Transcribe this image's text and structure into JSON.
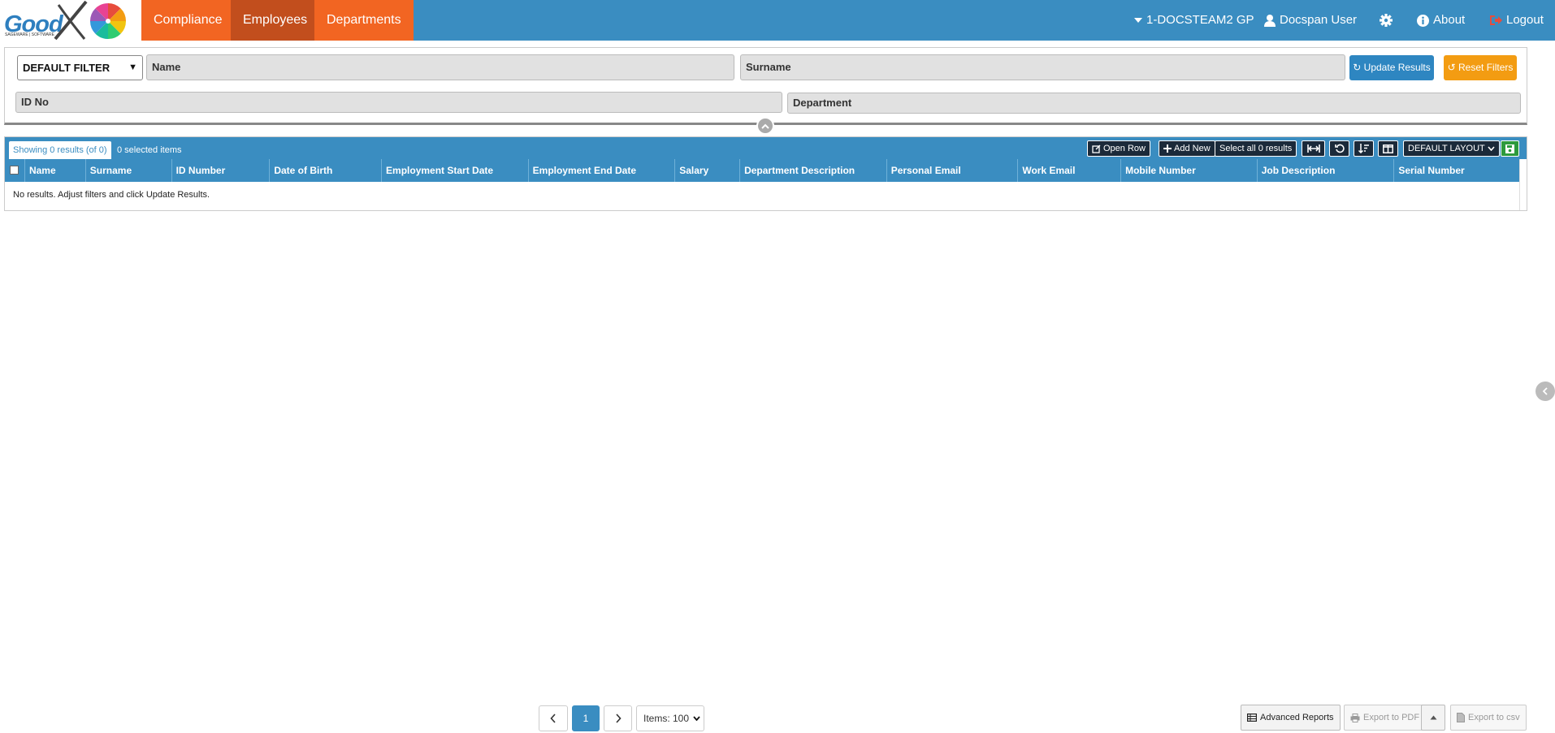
{
  "brand": {
    "name": "Good",
    "tagline": "SAGEWARE | SOFTWARE"
  },
  "nav": {
    "tabs": [
      {
        "label": "Compliance",
        "active": false
      },
      {
        "label": "Employees",
        "active": true
      },
      {
        "label": "Departments",
        "active": false
      }
    ],
    "practice": "1-DOCSTEAM2 GP",
    "user": "Docspan User",
    "about": "About",
    "logout": "Logout"
  },
  "filters": {
    "preset": "DEFAULT FILTER",
    "name": "Name",
    "surname": "Surname",
    "id_no": "ID No",
    "department": "Department",
    "update_label": "Update Results",
    "reset_label": "Reset Filters"
  },
  "results": {
    "showing": "Showing 0 results (of 0)",
    "selected": "0 selected items",
    "open_row": "Open Row",
    "add_new": "Add New",
    "select_all": "Select all 0 results",
    "layout": "DEFAULT LAYOUT",
    "columns": [
      "Name",
      "Surname",
      "ID Number",
      "Date of Birth",
      "Employment Start Date",
      "Employment End Date",
      "Salary",
      "Department Description",
      "Personal Email",
      "Work Email",
      "Mobile Number",
      "Job Description",
      "Serial Number"
    ],
    "empty_message": "No results. Adjust filters and click Update Results."
  },
  "pagination": {
    "current_page": "1",
    "items_per_page": "Items: 100"
  },
  "actions": {
    "advanced_reports": "Advanced Reports",
    "export_pdf": "Export to PDF",
    "export_csv": "Export to csv"
  },
  "colors": {
    "navbar": "#3a8dc1",
    "tab": "#f26522",
    "tab_active": "#c24e1d",
    "update": "#2e86c1",
    "reset": "#f39c12",
    "save": "#2c9a3d"
  }
}
